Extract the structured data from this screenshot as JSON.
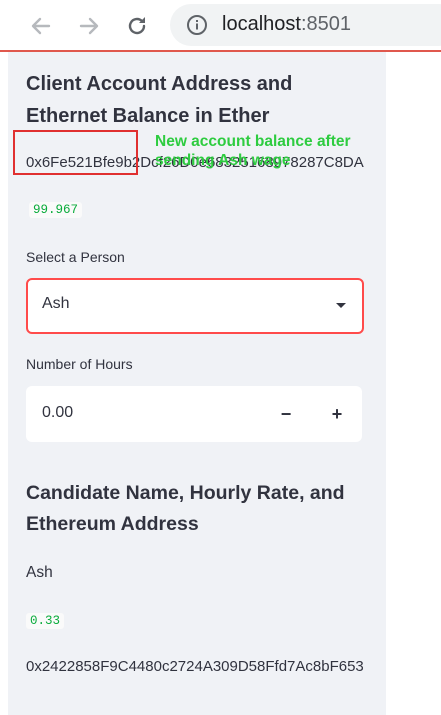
{
  "browser": {
    "url_host": "localhost",
    "url_port": ":8501"
  },
  "sidebar": {
    "client_section": {
      "heading": "Client Account Address and Ethernet Balance in Ether",
      "address": "0x6Fe521Bfe9b2Dcf26D0e68325168978287C8DA",
      "balance": "99.967"
    },
    "annotation": {
      "text": "New account balance after sending Ash wage",
      "color": "#2ecc40",
      "box_color": "#e03030"
    },
    "person_select": {
      "label": "Select a Person",
      "selected": "Ash"
    },
    "hours_input": {
      "label": "Number of Hours",
      "value": "0.00",
      "decrement": "−",
      "increment": "+"
    },
    "candidate_section": {
      "heading": "Candidate Name, Hourly Rate, and Ethereum Address",
      "name": "Ash",
      "rate": "0.33",
      "address": "0x2422858F9C4480c2724A309D58Ffd7Ac8bF653"
    }
  },
  "colors": {
    "accent": "#ff4b4b",
    "code_green": "#09ab3b",
    "sidebar_bg": "#f0f2f6"
  }
}
